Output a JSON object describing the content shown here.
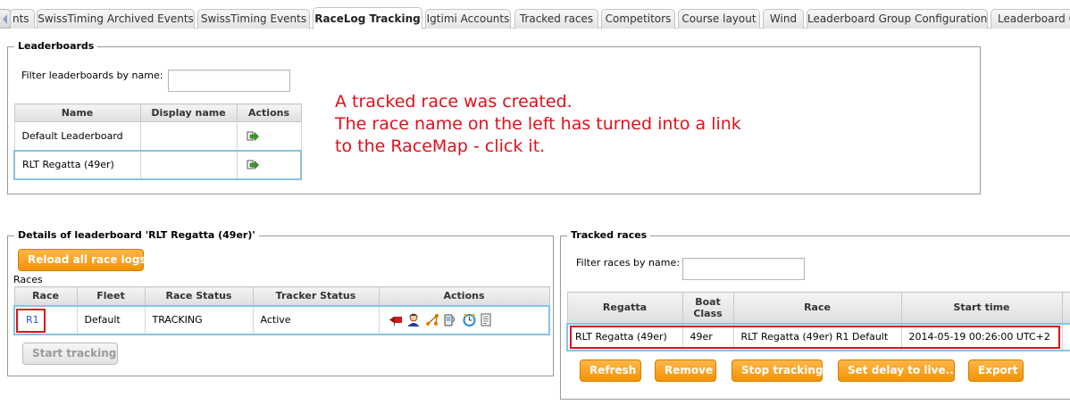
{
  "tabs": [
    {
      "label": "nts",
      "active": false
    },
    {
      "label": "SwissTiming Archived Events",
      "active": false
    },
    {
      "label": "SwissTiming Events",
      "active": false
    },
    {
      "label": "RaceLog Tracking",
      "active": true
    },
    {
      "label": "Igtimi Accounts",
      "active": false
    },
    {
      "label": "Tracked races",
      "active": false
    },
    {
      "label": "Competitors",
      "active": false
    },
    {
      "label": "Course layout",
      "active": false
    },
    {
      "label": "Wind",
      "active": false
    },
    {
      "label": "Leaderboard Group Configuration",
      "active": false
    },
    {
      "label": "Leaderboard C",
      "active": false
    }
  ],
  "leaderboards": {
    "legend": "Leaderboards",
    "filter_label": "Filter leaderboards by name:",
    "filter_value": "",
    "columns": [
      "Name",
      "Display name",
      "Actions"
    ],
    "rows": [
      {
        "name": "Default Leaderboard",
        "display_name": "",
        "action_icon": "edit-arrow-icon"
      },
      {
        "name": "RLT Regatta (49er)",
        "display_name": "",
        "action_icon": "edit-arrow-icon"
      }
    ]
  },
  "annotation": {
    "line1": "A tracked race was created.",
    "line2": "The race name on the left has turned into a link",
    "line3": "to the RaceMap - click it.",
    "color": "#e0101a"
  },
  "details": {
    "legend": "Details of leaderboard 'RLT Regatta (49er)'",
    "reload_button": "Reload all race logs",
    "races_label": "Races",
    "columns": [
      "Race",
      "Fleet",
      "Race Status",
      "Tracker Status",
      "Actions"
    ],
    "row": {
      "race": "R1",
      "fleet": "Default",
      "race_status": "TRACKING",
      "tracker_status": "Active"
    },
    "action_icons": [
      "flag-icon",
      "person-icon",
      "course-icon",
      "device-icon",
      "clock-icon",
      "document-icon"
    ],
    "start_tracking_button": "Start tracking"
  },
  "tracked": {
    "legend": "Tracked races",
    "filter_label": "Filter races by name:",
    "filter_value": "",
    "columns": [
      "Regatta",
      "Boat Class",
      "Race",
      "Start time"
    ],
    "row": {
      "regatta": "RLT Regatta (49er)",
      "boat_class": "49er",
      "race": "RLT Regatta (49er) R1 Default",
      "start_time": "2014-05-19 00:26:00 UTC+2"
    },
    "buttons": {
      "refresh": "Refresh",
      "remove": "Remove",
      "stop_tracking": "Stop tracking",
      "set_delay": "Set delay to live...",
      "export": "Export"
    }
  },
  "colors": {
    "accent_orange": "#f59300",
    "selection_blue": "#87c4e2",
    "link_blue": "#2a56c6"
  }
}
